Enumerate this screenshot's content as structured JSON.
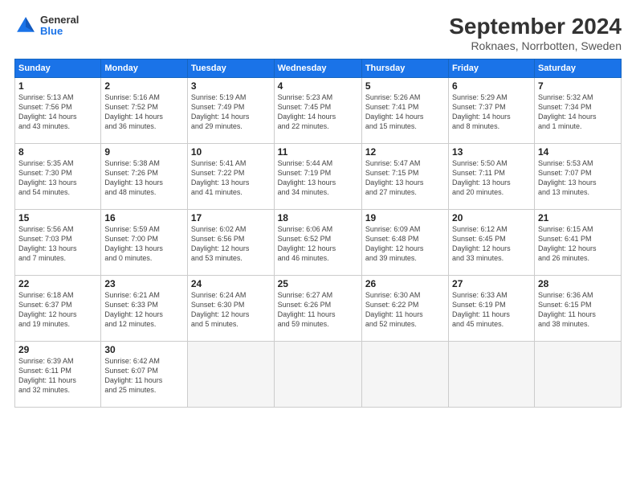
{
  "header": {
    "logo": {
      "line1": "General",
      "line2": "Blue"
    },
    "title": "September 2024",
    "subtitle": "Roknaes, Norrbotten, Sweden"
  },
  "weekdays": [
    "Sunday",
    "Monday",
    "Tuesday",
    "Wednesday",
    "Thursday",
    "Friday",
    "Saturday"
  ],
  "weeks": [
    [
      {
        "day": "1",
        "info": "Sunrise: 5:13 AM\nSunset: 7:56 PM\nDaylight: 14 hours\nand 43 minutes."
      },
      {
        "day": "2",
        "info": "Sunrise: 5:16 AM\nSunset: 7:52 PM\nDaylight: 14 hours\nand 36 minutes."
      },
      {
        "day": "3",
        "info": "Sunrise: 5:19 AM\nSunset: 7:49 PM\nDaylight: 14 hours\nand 29 minutes."
      },
      {
        "day": "4",
        "info": "Sunrise: 5:23 AM\nSunset: 7:45 PM\nDaylight: 14 hours\nand 22 minutes."
      },
      {
        "day": "5",
        "info": "Sunrise: 5:26 AM\nSunset: 7:41 PM\nDaylight: 14 hours\nand 15 minutes."
      },
      {
        "day": "6",
        "info": "Sunrise: 5:29 AM\nSunset: 7:37 PM\nDaylight: 14 hours\nand 8 minutes."
      },
      {
        "day": "7",
        "info": "Sunrise: 5:32 AM\nSunset: 7:34 PM\nDaylight: 14 hours\nand 1 minute."
      }
    ],
    [
      {
        "day": "8",
        "info": "Sunrise: 5:35 AM\nSunset: 7:30 PM\nDaylight: 13 hours\nand 54 minutes."
      },
      {
        "day": "9",
        "info": "Sunrise: 5:38 AM\nSunset: 7:26 PM\nDaylight: 13 hours\nand 48 minutes."
      },
      {
        "day": "10",
        "info": "Sunrise: 5:41 AM\nSunset: 7:22 PM\nDaylight: 13 hours\nand 41 minutes."
      },
      {
        "day": "11",
        "info": "Sunrise: 5:44 AM\nSunset: 7:19 PM\nDaylight: 13 hours\nand 34 minutes."
      },
      {
        "day": "12",
        "info": "Sunrise: 5:47 AM\nSunset: 7:15 PM\nDaylight: 13 hours\nand 27 minutes."
      },
      {
        "day": "13",
        "info": "Sunrise: 5:50 AM\nSunset: 7:11 PM\nDaylight: 13 hours\nand 20 minutes."
      },
      {
        "day": "14",
        "info": "Sunrise: 5:53 AM\nSunset: 7:07 PM\nDaylight: 13 hours\nand 13 minutes."
      }
    ],
    [
      {
        "day": "15",
        "info": "Sunrise: 5:56 AM\nSunset: 7:03 PM\nDaylight: 13 hours\nand 7 minutes."
      },
      {
        "day": "16",
        "info": "Sunrise: 5:59 AM\nSunset: 7:00 PM\nDaylight: 13 hours\nand 0 minutes."
      },
      {
        "day": "17",
        "info": "Sunrise: 6:02 AM\nSunset: 6:56 PM\nDaylight: 12 hours\nand 53 minutes."
      },
      {
        "day": "18",
        "info": "Sunrise: 6:06 AM\nSunset: 6:52 PM\nDaylight: 12 hours\nand 46 minutes."
      },
      {
        "day": "19",
        "info": "Sunrise: 6:09 AM\nSunset: 6:48 PM\nDaylight: 12 hours\nand 39 minutes."
      },
      {
        "day": "20",
        "info": "Sunrise: 6:12 AM\nSunset: 6:45 PM\nDaylight: 12 hours\nand 33 minutes."
      },
      {
        "day": "21",
        "info": "Sunrise: 6:15 AM\nSunset: 6:41 PM\nDaylight: 12 hours\nand 26 minutes."
      }
    ],
    [
      {
        "day": "22",
        "info": "Sunrise: 6:18 AM\nSunset: 6:37 PM\nDaylight: 12 hours\nand 19 minutes."
      },
      {
        "day": "23",
        "info": "Sunrise: 6:21 AM\nSunset: 6:33 PM\nDaylight: 12 hours\nand 12 minutes."
      },
      {
        "day": "24",
        "info": "Sunrise: 6:24 AM\nSunset: 6:30 PM\nDaylight: 12 hours\nand 5 minutes."
      },
      {
        "day": "25",
        "info": "Sunrise: 6:27 AM\nSunset: 6:26 PM\nDaylight: 11 hours\nand 59 minutes."
      },
      {
        "day": "26",
        "info": "Sunrise: 6:30 AM\nSunset: 6:22 PM\nDaylight: 11 hours\nand 52 minutes."
      },
      {
        "day": "27",
        "info": "Sunrise: 6:33 AM\nSunset: 6:19 PM\nDaylight: 11 hours\nand 45 minutes."
      },
      {
        "day": "28",
        "info": "Sunrise: 6:36 AM\nSunset: 6:15 PM\nDaylight: 11 hours\nand 38 minutes."
      }
    ],
    [
      {
        "day": "29",
        "info": "Sunrise: 6:39 AM\nSunset: 6:11 PM\nDaylight: 11 hours\nand 32 minutes."
      },
      {
        "day": "30",
        "info": "Sunrise: 6:42 AM\nSunset: 6:07 PM\nDaylight: 11 hours\nand 25 minutes."
      },
      {
        "day": "",
        "info": ""
      },
      {
        "day": "",
        "info": ""
      },
      {
        "day": "",
        "info": ""
      },
      {
        "day": "",
        "info": ""
      },
      {
        "day": "",
        "info": ""
      }
    ]
  ]
}
